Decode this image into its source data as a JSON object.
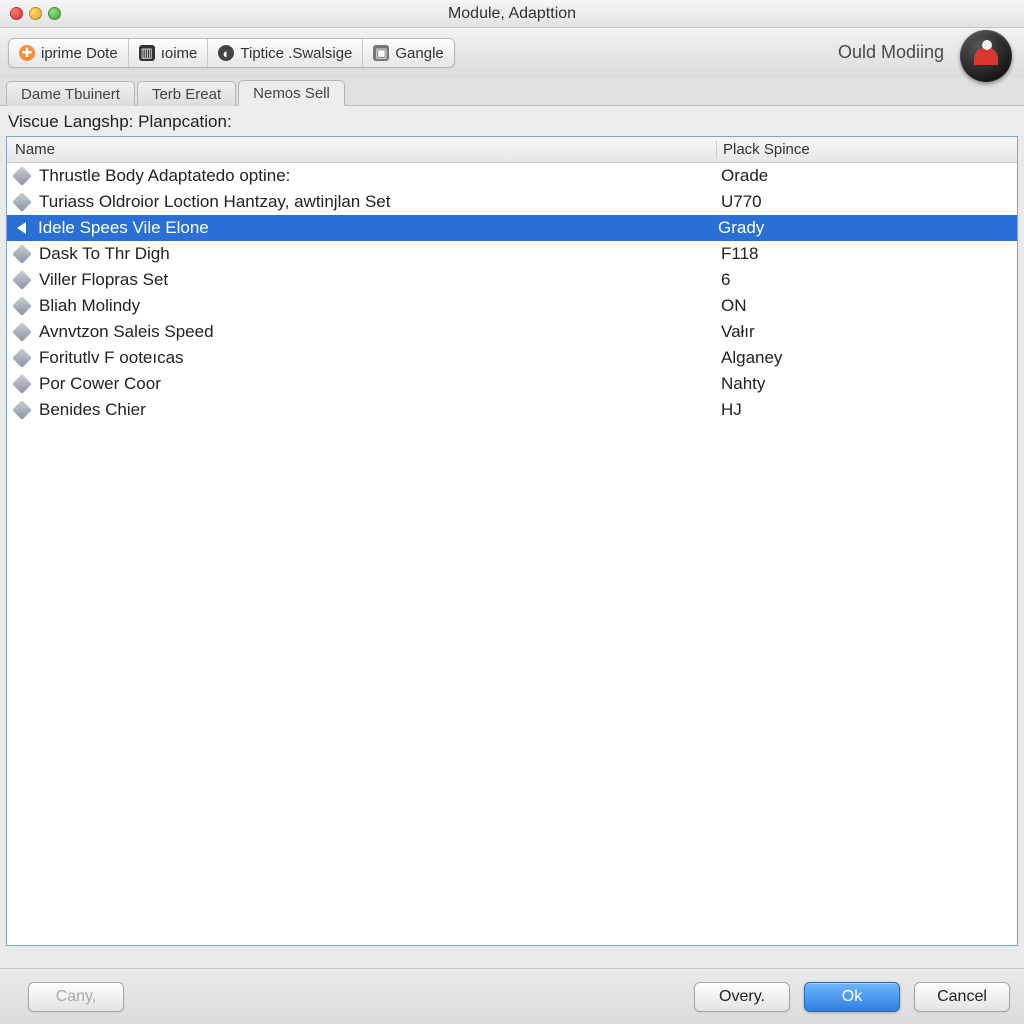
{
  "window": {
    "title": "Module, Adapttion"
  },
  "toolbar": {
    "buttons": [
      {
        "label": "iprime Dote"
      },
      {
        "label": "ıoime"
      },
      {
        "label": "Tiptice .Swalsige"
      },
      {
        "label": "Gangle"
      }
    ]
  },
  "brand": {
    "label": "Ould Modiing"
  },
  "tabs": {
    "items": [
      {
        "label": "Dame Tbuinert"
      },
      {
        "label": "Terb Ereat"
      },
      {
        "label": "Nemos Sell"
      }
    ],
    "activeIndex": 2
  },
  "subheader": "Viscue Langshp: Planpcation:",
  "table": {
    "columns": {
      "name": "Name",
      "value": "Plack Spince"
    },
    "rows": [
      {
        "name": "Thrustle Body Adaptatedo optine:",
        "value": "Orade",
        "selected": false
      },
      {
        "name": "Turiass Oldroior Loction Hantzay, awtinjlan Set",
        "value": "U770",
        "selected": false
      },
      {
        "name": "Idele Spees Vile Elone",
        "value": "Grady",
        "selected": true
      },
      {
        "name": "Dask To Thr Digh",
        "value": "F118",
        "selected": false
      },
      {
        "name": "Viller Flopras Set",
        "value": "6",
        "selected": false
      },
      {
        "name": "Bliah Molindy",
        "value": "ON",
        "selected": false
      },
      {
        "name": "Avnvtzon Saleis Speed",
        "value": "Vałır",
        "selected": false
      },
      {
        "name": "Foritutlv F ooteıcas",
        "value": "Alganey",
        "selected": false
      },
      {
        "name": "Por Cower Coor",
        "value": "Nahty",
        "selected": false
      },
      {
        "name": "Benides Chier",
        "value": "HJ",
        "selected": false
      }
    ]
  },
  "footer": {
    "cany": "Cany,",
    "overy": "Overy.",
    "ok": "Ok",
    "cancel": "Cancel"
  }
}
